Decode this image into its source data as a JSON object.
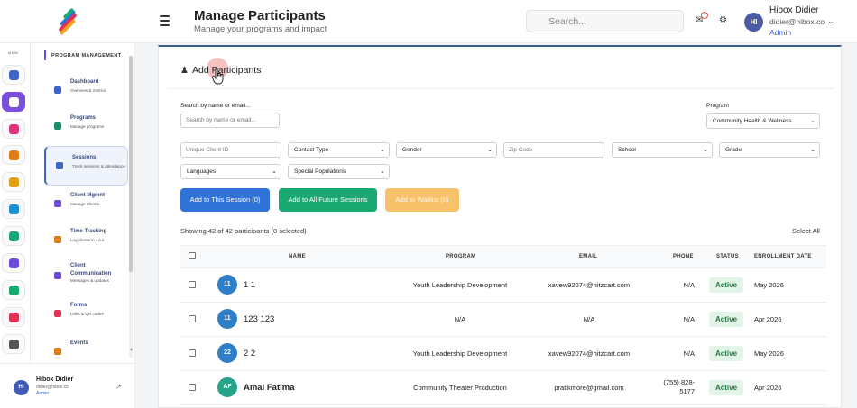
{
  "header": {
    "title": "Manage Participants",
    "subtitle": "Manage your programs and impact",
    "search_placeholder": "Search...",
    "user_name": "Hibox Didier",
    "user_email": "didier@hibox.co",
    "user_role": "Admin",
    "avatar_initials": "HI"
  },
  "rail": {
    "label": "MAIN",
    "items": [
      {
        "icon": "home-icon",
        "color": "#3e63c9"
      },
      {
        "icon": "org-chart-icon",
        "color": "#7a4fe0",
        "active": true
      },
      {
        "icon": "handshake-icon",
        "color": "#e0317a"
      },
      {
        "icon": "document-icon",
        "color": "#e07b16"
      },
      {
        "icon": "graduation-icon",
        "color": "#e0a016"
      },
      {
        "icon": "globe-icon",
        "color": "#1a8fd1"
      },
      {
        "icon": "network-icon",
        "color": "#1aa872"
      },
      {
        "icon": "edit-form-icon",
        "color": "#6d4bd8"
      },
      {
        "icon": "people-icon",
        "color": "#1aa872"
      },
      {
        "icon": "pie-chart-icon",
        "color": "#e03157"
      },
      {
        "icon": "settings-icon",
        "color": "#555555"
      }
    ]
  },
  "nav": {
    "header": "PROGRAM MANAGEMENT",
    "items": [
      {
        "title": "Dashboard",
        "sub": "Overview & metrics",
        "icon": "dashboard-icon",
        "color": "#3e63c9"
      },
      {
        "title": "Programs",
        "sub": "Manage programs",
        "icon": "programs-icon",
        "color": "#1a8f6a"
      },
      {
        "title": "Sessions",
        "sub": "Track sessions & attendance",
        "icon": "sessions-icon",
        "color": "#3e63c9",
        "active": true
      },
      {
        "title": "Client Mgmnt",
        "sub": "Manage Clients",
        "icon": "clients-icon",
        "color": "#6d4bd8"
      },
      {
        "title": "Time Tracking",
        "sub": "Log clients in / out",
        "icon": "clock-icon",
        "color": "#e07b16"
      },
      {
        "title": "Client Communication",
        "sub": "Messages & updates",
        "icon": "chat-icon",
        "color": "#6d4bd8"
      },
      {
        "title": "Forms",
        "sub": "Links & QR codes",
        "icon": "forms-icon",
        "color": "#e03157"
      },
      {
        "title": "Events",
        "sub": "",
        "icon": "events-icon",
        "color": "#e07b16"
      }
    ]
  },
  "side_user": {
    "name": "Hibox Didier",
    "email": "didier@hibox.co",
    "role": "Admin",
    "initials": "HI"
  },
  "panel": {
    "title": "Add Participants",
    "search_label": "Search by name or email...",
    "search_placeholder": "Search by name or email...",
    "program_label": "Program",
    "program_value": "Community Health & Wellness",
    "client_id_placeholder": "Unique Client ID",
    "contact_type": "Contact Type",
    "gender": "Gender",
    "zip_placeholder": "Zip Code",
    "school": "School",
    "grade": "Grade",
    "languages": "Languages",
    "special_populations": "Special Populations",
    "btn_session": "Add to This Session (0)",
    "btn_future": "Add to All Future Sessions",
    "btn_waitlist": "Add to Waitlist (0)",
    "showing": "Showing 42 of 42 participants (0 selected)",
    "select_all": "Select All"
  },
  "table": {
    "headers": {
      "name": "NAME",
      "program": "PROGRAM",
      "email": "EMAIL",
      "phone": "PHONE",
      "status": "STATUS",
      "enrollment": "ENROLLMENT DATE"
    },
    "rows": [
      {
        "initials": "11",
        "name": "1 1",
        "program": "Youth Leadership Development",
        "email": "xavew92074@hitzcart.com",
        "phone": "N/A",
        "phone2": "",
        "status": "Active",
        "date": "May 2026"
      },
      {
        "initials": "11",
        "name": "123 123",
        "program": "N/A",
        "email": "N/A",
        "phone": "N/A",
        "phone2": "",
        "status": "Active",
        "date": "Apr 2026"
      },
      {
        "initials": "22",
        "name": "2 2",
        "program": "Youth Leadership Development",
        "email": "xavew92074@hitzcart.com",
        "phone": "N/A",
        "phone2": "",
        "status": "Active",
        "date": "May 2026"
      },
      {
        "initials": "AF",
        "name": "Amal Fatima",
        "program": "Community Theater Production",
        "email": "pratikmore@gmail.com",
        "phone": "(755) 828-",
        "phone2": "5177",
        "status": "Active",
        "date": "Apr 2026"
      }
    ]
  }
}
